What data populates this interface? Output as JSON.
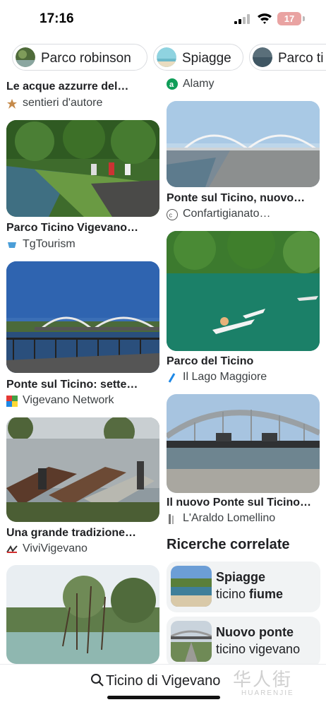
{
  "status_bar": {
    "time": "17:16",
    "battery": "17"
  },
  "chips": [
    {
      "label": "Parco robinson"
    },
    {
      "label": "Spiagge"
    },
    {
      "label": "Parco ti"
    }
  ],
  "left_column": [
    {
      "title": "Le acque azzurre del…",
      "source": "sentieri d'autore"
    },
    {
      "title": "Parco Ticino Vigevano…",
      "source": "TgTourism"
    },
    {
      "title": "Ponte sul Ticino: sette…",
      "source": "Vigevano Network"
    },
    {
      "title": "Una grande tradizione…",
      "source": "ViviVigevano"
    }
  ],
  "right_column": [
    {
      "source": "Alamy"
    },
    {
      "title": "Ponte sul Ticino, nuovo…",
      "source": "Confartigianato…"
    },
    {
      "title": "Parco del Ticino",
      "source": "Il Lago Maggiore"
    },
    {
      "title": "Il nuovo Ponte sul Ticino…",
      "source": "L'Araldo Lomellino"
    }
  ],
  "related": {
    "heading": "Ricerche correlate",
    "items": [
      {
        "bold": "Spiagge",
        "line2_pre": "ticino ",
        "line2_bold": "fiume"
      },
      {
        "bold": "Nuovo ponte",
        "line2_pre": "ticino vigevano",
        "line2_bold": ""
      }
    ]
  },
  "search": {
    "query": "Ticino di Vigevano"
  },
  "watermark": {
    "text": "华人街",
    "sub": "HUARENJIE"
  },
  "colors": {
    "chip_border": "#dadce0",
    "related_bg": "#f1f3f4",
    "battery": "#e9a3a2"
  }
}
